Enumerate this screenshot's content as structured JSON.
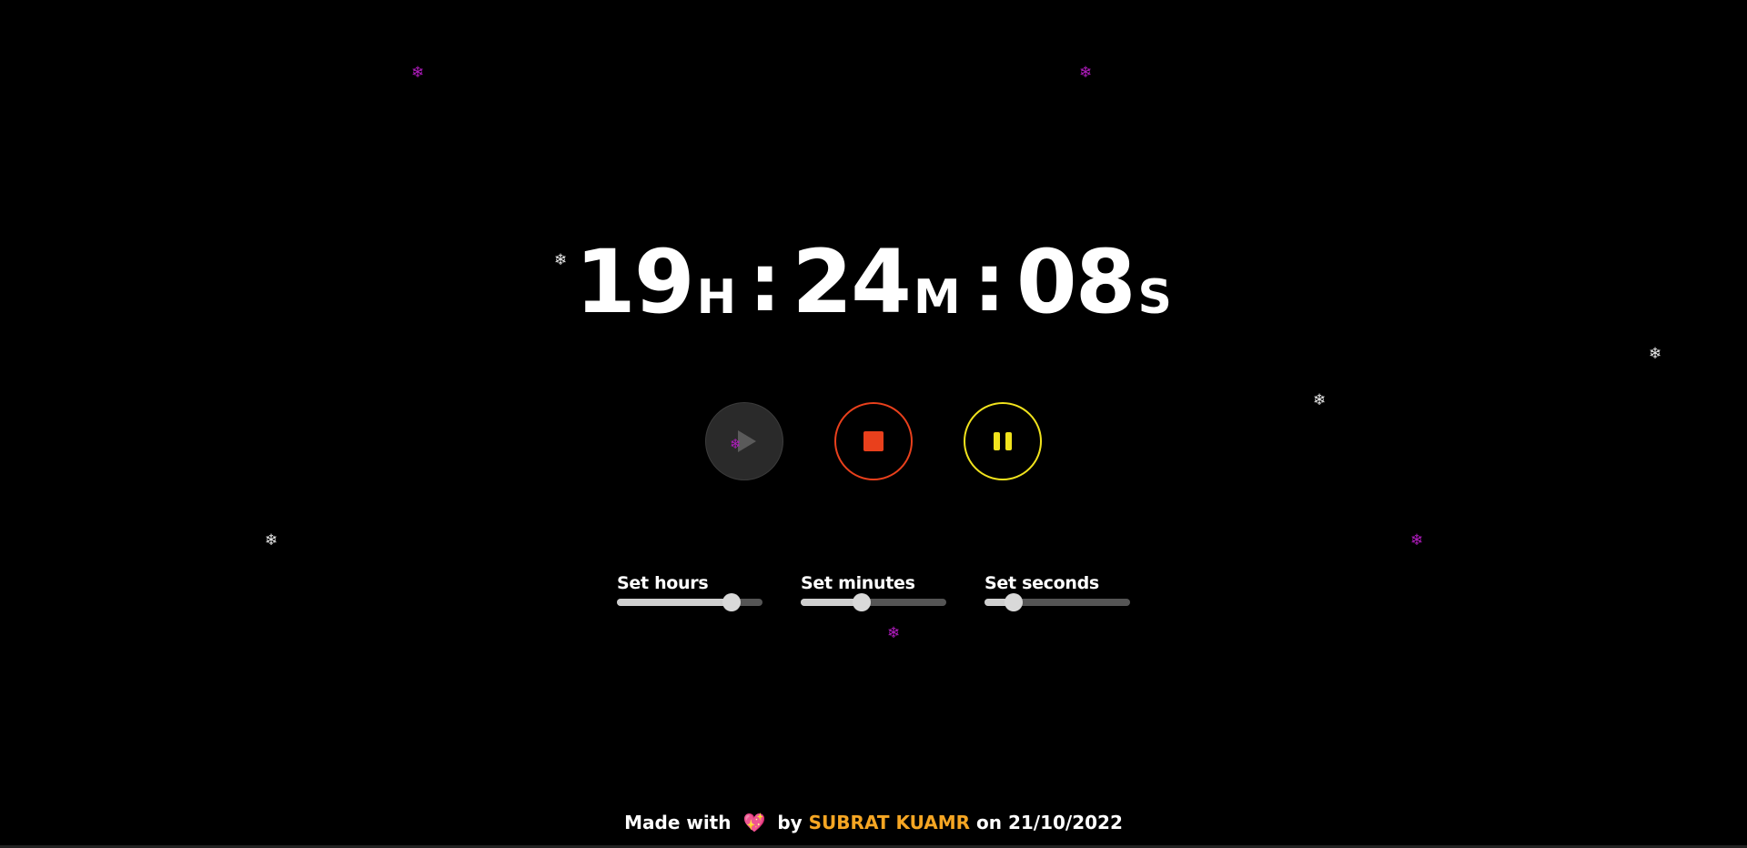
{
  "timer": {
    "hours": "19",
    "hours_unit": "H",
    "minutes": "24",
    "minutes_unit": "M",
    "seconds": "08",
    "seconds_unit": "S",
    "separator": ":"
  },
  "controls": {
    "play_icon": "play-icon",
    "stop_icon": "stop-icon",
    "pause_icon": "pause-icon",
    "play_color": "#5a5a5a",
    "stop_color": "#e9401c",
    "pause_color": "#f1e31d"
  },
  "sliders": [
    {
      "label": "Set hours",
      "value_fraction": 0.79
    },
    {
      "label": "Set minutes",
      "value_fraction": 0.42
    },
    {
      "label": "Set seconds",
      "value_fraction": 0.2
    }
  ],
  "footer": {
    "prefix": "Made with",
    "heart": "💖",
    "by": "by",
    "author": "SUBRAT KUAMR",
    "on": "on",
    "date": "21/10/2022"
  },
  "decorations": {
    "flake_glyph": "❄",
    "flake_colors": [
      "#eaeaea",
      "#b21cc0"
    ]
  }
}
